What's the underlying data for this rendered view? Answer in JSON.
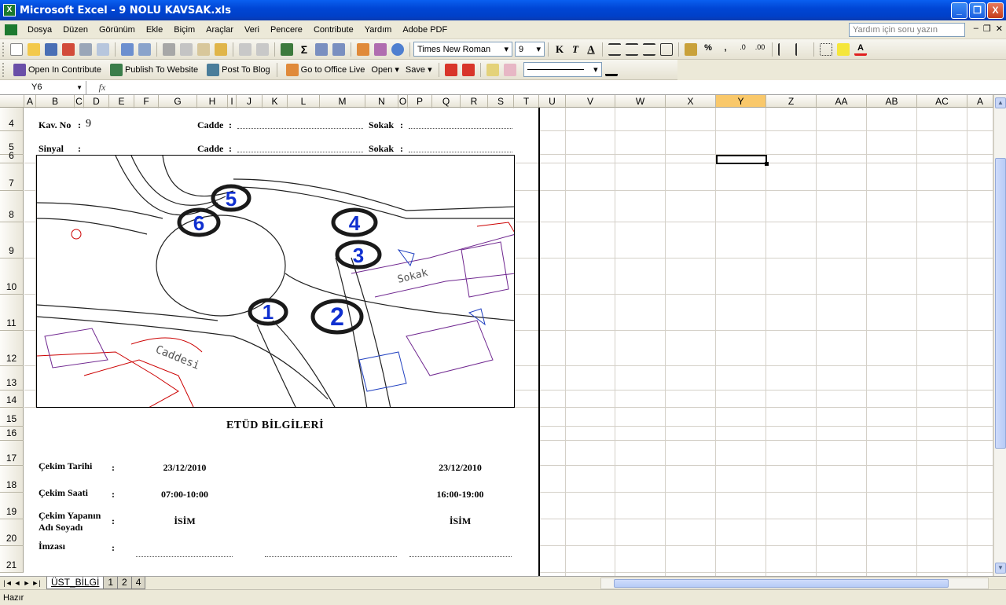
{
  "window": {
    "title": "Microsoft Excel - 9 NOLU KAVSAK.xls",
    "buttons": [
      "_",
      "❐",
      "X"
    ]
  },
  "menu": {
    "items": [
      "Dosya",
      "Düzen",
      "Görünüm",
      "Ekle",
      "Biçim",
      "Araçlar",
      "Veri",
      "Pencere",
      "Contribute",
      "Yardım",
      "Adobe PDF"
    ],
    "help_placeholder": "Yardım için soru yazın"
  },
  "formatting": {
    "font": "Times New Roman",
    "size": "9",
    "bold": "K",
    "italic": "T",
    "underline": "A"
  },
  "toolbar2": {
    "open_in_contribute": "Open In Contribute",
    "publish_to_website": "Publish To Website",
    "post_to_blog": "Post To Blog",
    "go_to_office_live": "Go to Office Live",
    "open": "Open",
    "save": "Save"
  },
  "formula_bar": {
    "name_box": "Y6",
    "fx": "fx",
    "value": ""
  },
  "columns": [
    {
      "label": "A",
      "active": false
    },
    {
      "label": "B",
      "active": false
    },
    {
      "label": "C",
      "active": false
    },
    {
      "label": "D",
      "active": false
    },
    {
      "label": "E",
      "active": false
    },
    {
      "label": "F",
      "active": false
    },
    {
      "label": "G",
      "active": false
    },
    {
      "label": "H",
      "active": false
    },
    {
      "label": "I",
      "active": false
    },
    {
      "label": "J",
      "active": false
    },
    {
      "label": "K",
      "active": false
    },
    {
      "label": "L",
      "active": false
    },
    {
      "label": "M",
      "active": false
    },
    {
      "label": "N",
      "active": false
    },
    {
      "label": "O",
      "active": false
    },
    {
      "label": "P",
      "active": false
    },
    {
      "label": "Q",
      "active": false
    },
    {
      "label": "R",
      "active": false
    },
    {
      "label": "S",
      "active": false
    },
    {
      "label": "T",
      "active": false
    },
    {
      "label": "U",
      "active": false
    },
    {
      "label": "V",
      "active": false
    },
    {
      "label": "W",
      "active": false
    },
    {
      "label": "X",
      "active": false
    },
    {
      "label": "Y",
      "active": true
    },
    {
      "label": "Z",
      "active": false
    },
    {
      "label": "AA",
      "active": false
    },
    {
      "label": "AB",
      "active": false
    },
    {
      "label": "AC",
      "active": false
    },
    {
      "label": "A",
      "active": false
    }
  ],
  "rows": [
    "4",
    "5",
    "6",
    "7",
    "8",
    "9",
    "10",
    "11",
    "12",
    "13",
    "14",
    "15",
    "16",
    "17",
    "18",
    "19",
    "20",
    "21"
  ],
  "form": {
    "kav_no_label": "Kav. No",
    "kav_no_colon": ":",
    "kav_no_value": "9",
    "sinyal_label": "Sinyal",
    "sinyal_colon": ":",
    "cadde_label": "Cadde",
    "sokak_label": "Sokak",
    "colon": ":",
    "section_title": "ETÜD BİLGİLERİ",
    "cekim_tarihi_label": "Çekim Tarihi",
    "cekim_saati_label": "Çekim Saati",
    "cekim_yapan_label_1": "Çekim Yapanın",
    "cekim_yapan_label_2": "Adı Soyadı",
    "imzasi_label": "İmzası",
    "date_1": "23/12/2010",
    "date_2": "23/12/2010",
    "time_1": "07:00-10:00",
    "time_2": "16:00-19:00",
    "name_1": "İSİM",
    "name_2": "İSİM"
  },
  "map_image": {
    "approach_numbers": [
      "1",
      "2",
      "3",
      "4",
      "5",
      "6"
    ],
    "street_text": "Sokak",
    "avenue_text": "Caddesi"
  },
  "sheet_tabs": [
    "ÜST_BİLGİ",
    "1",
    "2",
    "4"
  ],
  "tab_nav": [
    "|◄",
    "◄",
    "►",
    "►|"
  ],
  "status": "Hazır"
}
